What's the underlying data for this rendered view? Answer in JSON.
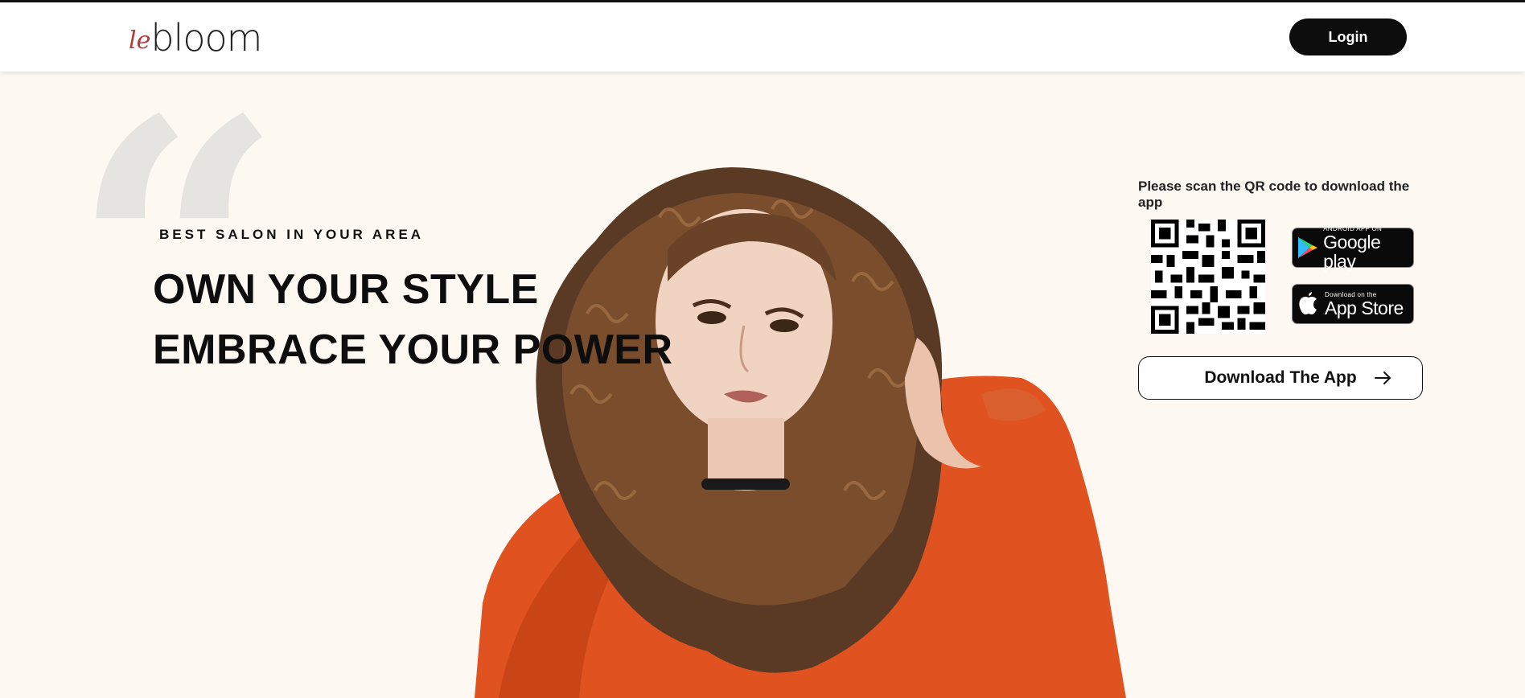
{
  "header": {
    "logo": {
      "prefix": "le",
      "name": "bloom"
    },
    "login_label": "Login"
  },
  "hero": {
    "eyebrow": "BEST SALON IN YOUR AREA",
    "headline_line1": "OWN YOUR STYLE",
    "headline_line2": "EMBRACE YOUR POWER",
    "quote_glyph": "“",
    "photo_icon": "woman-portrait-image"
  },
  "download": {
    "caption": "Please scan the QR code to download the app",
    "qr_icon": "qr-code-icon",
    "google_play": {
      "small": "ANDROID APP ON",
      "big": "Google play",
      "icon": "google-play-icon"
    },
    "app_store": {
      "small": "Download on the",
      "big": "App Store",
      "icon": "apple-icon"
    },
    "button_label": "Download The App",
    "button_icon": "arrow-right-icon"
  },
  "colors": {
    "background": "#fdf9f2",
    "accent_logo": "#b23b3b",
    "button_dark": "#0d0d0d",
    "jacket_orange": "#e0521f"
  }
}
